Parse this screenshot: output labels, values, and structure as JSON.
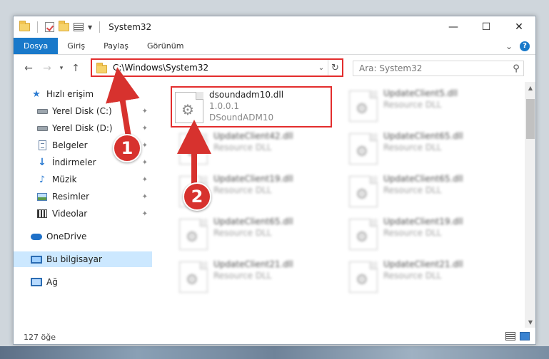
{
  "window": {
    "title": "System32",
    "minimize": "—",
    "maximize": "☐",
    "close": "✕"
  },
  "ribbon": {
    "tabs": [
      "Dosya",
      "Giriş",
      "Paylaş",
      "Görünüm"
    ],
    "collapse": "⌄",
    "help": "?"
  },
  "nav": {
    "back": "←",
    "forward": "→",
    "recent": "▾",
    "up": "↑"
  },
  "address": {
    "path": "C:\\Windows\\System32",
    "dropdown": "⌄",
    "refresh": "↻"
  },
  "search": {
    "placeholder": "Ara: System32",
    "icon": "⚲"
  },
  "sidebar": {
    "items": [
      {
        "label": "Hızlı erişim",
        "icon": "star-icon",
        "pinned": false
      },
      {
        "label": "Yerel Disk (C:)",
        "icon": "drive-icon",
        "pinned": true
      },
      {
        "label": "Yerel Disk (D:)",
        "icon": "drive-icon",
        "pinned": true
      },
      {
        "label": "Belgeler",
        "icon": "documents-icon",
        "pinned": true
      },
      {
        "label": "İndirmeler",
        "icon": "download-icon",
        "pinned": true
      },
      {
        "label": "Müzik",
        "icon": "music-icon",
        "pinned": true
      },
      {
        "label": "Resimler",
        "icon": "pictures-icon",
        "pinned": true
      },
      {
        "label": "Videolar",
        "icon": "videos-icon",
        "pinned": true
      },
      {
        "label": "OneDrive",
        "icon": "onedrive-icon",
        "pinned": false
      },
      {
        "label": "Bu bilgisayar",
        "icon": "computer-icon",
        "pinned": false
      },
      {
        "label": "Ağ",
        "icon": "network-icon",
        "pinned": false
      }
    ],
    "pin_glyph": "📌"
  },
  "files": [
    {
      "name": "dsoundadm10.dll",
      "line2": "1.0.0.1",
      "line3": "DSoundADM10"
    },
    {
      "name": "UpdateClient5.dll",
      "line2": "Resource DLL"
    },
    {
      "name": "UpdateClient42.dll",
      "line2": "Resource DLL"
    },
    {
      "name": "UpdateClient65.dll",
      "line2": "Resource DLL"
    },
    {
      "name": "UpdateClient19.dll",
      "line2": "Resource DLL"
    },
    {
      "name": "UpdateClient65.dll",
      "line2": "Resource DLL"
    },
    {
      "name": "UpdateClient65.dll",
      "line2": "Resource DLL"
    },
    {
      "name": "UpdateClient19.dll",
      "line2": "Resource DLL"
    },
    {
      "name": "UpdateClient21.dll",
      "line2": "Resource DLL"
    },
    {
      "name": "UpdateClient21.dll",
      "line2": "Resource DLL"
    }
  ],
  "status": {
    "count": "127 öğe"
  },
  "annotations": {
    "badge1": "1",
    "badge2": "2",
    "color": "#d7322e"
  },
  "scroll": {
    "up": "▲",
    "down": "▼"
  }
}
